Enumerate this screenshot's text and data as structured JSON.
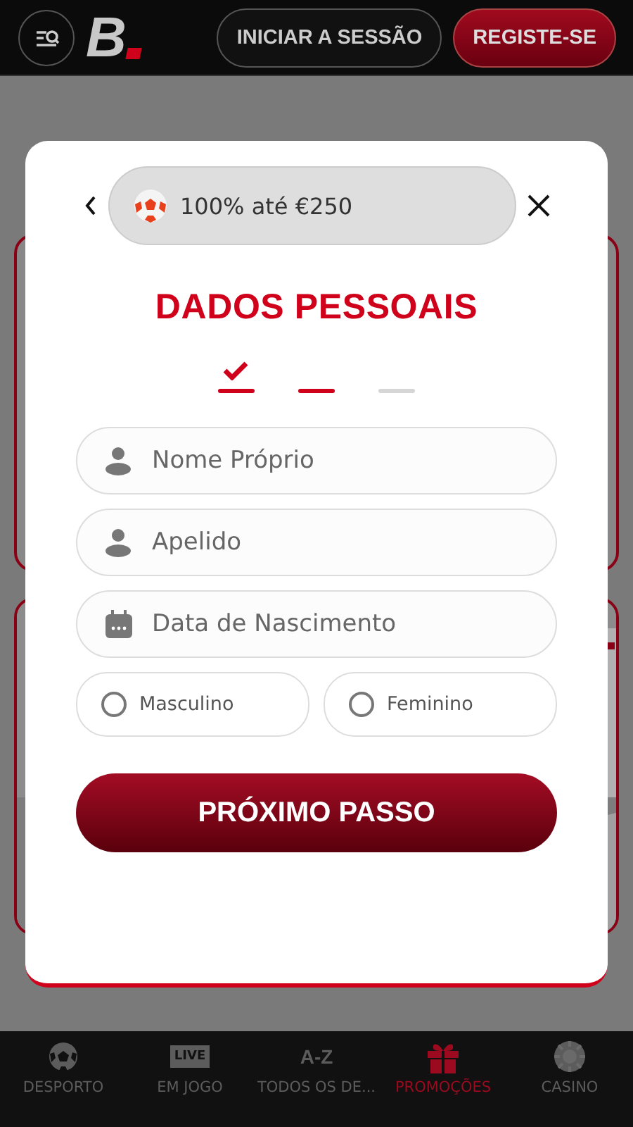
{
  "header": {
    "logo": "B",
    "buttons": [
      {
        "label": "INICIAR A SESSÃO",
        "kind": "outline"
      },
      {
        "label": "REGISTE-SE",
        "kind": "primary"
      }
    ]
  },
  "modal": {
    "offer": "100% até €250",
    "title": "DADOS PESSOAIS",
    "steps": [
      {
        "done": true,
        "active": true
      },
      {
        "done": false,
        "active": true
      },
      {
        "done": false,
        "active": false
      }
    ],
    "fields": [
      {
        "kind": "person",
        "placeholder": "Nome Próprio"
      },
      {
        "kind": "person",
        "placeholder": "Apelido"
      },
      {
        "kind": "date",
        "placeholder": "Data de Nascimento"
      }
    ],
    "gender": [
      {
        "label": "Masculino",
        "selected": false
      },
      {
        "label": "Feminino",
        "selected": false
      }
    ],
    "button": "PRÓXIMO PASSO"
  },
  "nav": [
    {
      "kind": "ball",
      "label": "DESPORTO",
      "selected": false
    },
    {
      "kind": "live",
      "label": "EM JOGO",
      "selected": false,
      "icon_text": "LIVE"
    },
    {
      "kind": "az",
      "label": "TODOS OS DE...",
      "selected": false,
      "icon_text": "A-Z"
    },
    {
      "kind": "gift",
      "label": "PROMOÇÕES",
      "selected": true
    },
    {
      "kind": "chip",
      "label": "CASINO",
      "selected": false
    }
  ]
}
